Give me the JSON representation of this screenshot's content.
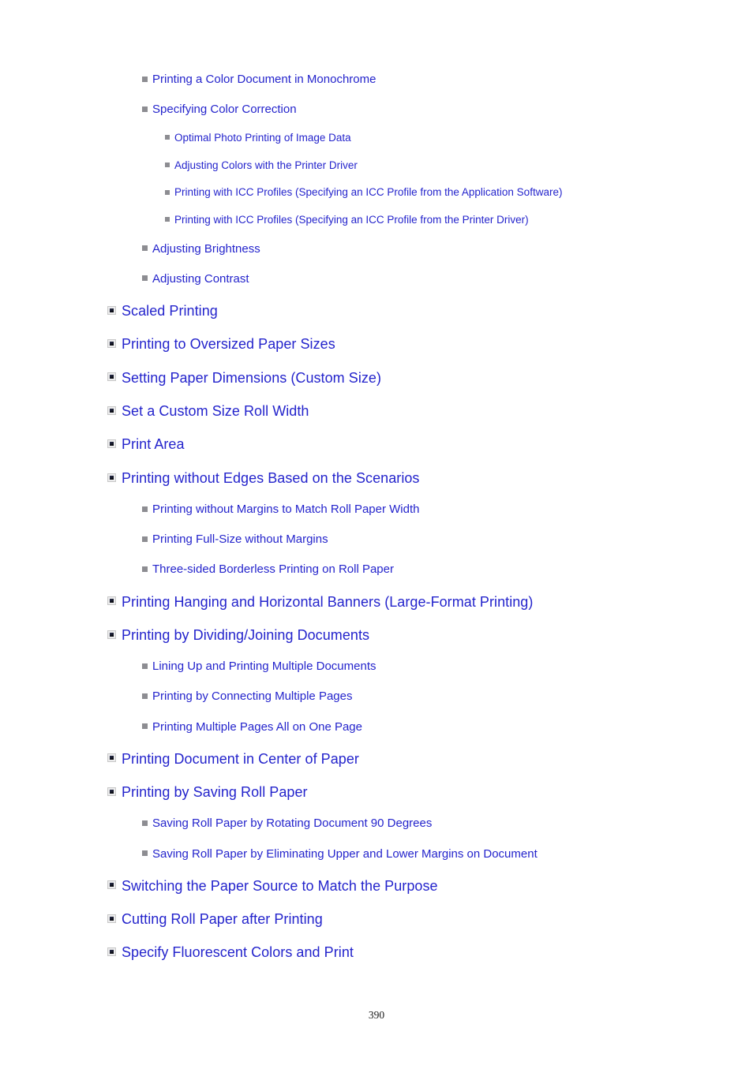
{
  "document": {
    "page_number": "390",
    "link_color": "#2424cc",
    "bullet_level1_color": "#17192c",
    "bullet_sub_color": "#8d8d92",
    "background_color": "#ffffff"
  },
  "toc": {
    "items": [
      {
        "level": 2,
        "bullet": "square-bullet-gray",
        "label": "Printing a Color Document in Monochrome"
      },
      {
        "level": 2,
        "bullet": "square-bullet-gray",
        "label": "Specifying Color Correction"
      },
      {
        "level": 3,
        "bullet": "square-bullet-gray-small",
        "label": "Optimal Photo Printing of Image Data"
      },
      {
        "level": 3,
        "bullet": "square-bullet-gray-small",
        "label": "Adjusting Colors with the Printer Driver"
      },
      {
        "level": 3,
        "bullet": "square-bullet-gray-small",
        "label": "Printing with ICC Profiles (Specifying an ICC Profile from the Application Software)"
      },
      {
        "level": 3,
        "bullet": "square-bullet-gray-small",
        "label": "Printing with ICC Profiles (Specifying an ICC Profile from the Printer Driver)"
      },
      {
        "level": 2,
        "bullet": "square-bullet-gray",
        "label": "Adjusting Brightness"
      },
      {
        "level": 2,
        "bullet": "square-bullet-gray",
        "label": "Adjusting Contrast"
      },
      {
        "level": 1,
        "bullet": "square-bullet-framed",
        "label": "Scaled Printing"
      },
      {
        "level": 1,
        "bullet": "square-bullet-framed",
        "label": "Printing to Oversized Paper Sizes"
      },
      {
        "level": 1,
        "bullet": "square-bullet-framed",
        "label": "Setting Paper Dimensions (Custom Size)"
      },
      {
        "level": 1,
        "bullet": "square-bullet-framed",
        "label": "Set a Custom Size Roll Width"
      },
      {
        "level": 1,
        "bullet": "square-bullet-framed",
        "label": "Print Area"
      },
      {
        "level": 1,
        "bullet": "square-bullet-framed",
        "label": "Printing without Edges Based on the Scenarios"
      },
      {
        "level": 2,
        "bullet": "square-bullet-gray",
        "label": "Printing without Margins to Match Roll Paper Width"
      },
      {
        "level": 2,
        "bullet": "square-bullet-gray",
        "label": "Printing Full-Size without Margins"
      },
      {
        "level": 2,
        "bullet": "square-bullet-gray",
        "label": "Three-sided Borderless Printing on Roll Paper"
      },
      {
        "level": 1,
        "bullet": "square-bullet-framed",
        "label": "Printing Hanging and Horizontal Banners (Large-Format Printing)"
      },
      {
        "level": 1,
        "bullet": "square-bullet-framed",
        "label": "Printing by Dividing/Joining Documents"
      },
      {
        "level": 2,
        "bullet": "square-bullet-gray",
        "label": "Lining Up and Printing Multiple Documents"
      },
      {
        "level": 2,
        "bullet": "square-bullet-gray",
        "label": "Printing by Connecting Multiple Pages"
      },
      {
        "level": 2,
        "bullet": "square-bullet-gray",
        "label": "Printing Multiple Pages All on One Page"
      },
      {
        "level": 1,
        "bullet": "square-bullet-framed",
        "label": "Printing Document in Center of Paper"
      },
      {
        "level": 1,
        "bullet": "square-bullet-framed",
        "label": "Printing by Saving Roll Paper"
      },
      {
        "level": 2,
        "bullet": "square-bullet-gray",
        "label": "Saving Roll Paper by Rotating Document 90 Degrees"
      },
      {
        "level": 2,
        "bullet": "square-bullet-gray",
        "label": "Saving Roll Paper by Eliminating Upper and Lower Margins on Document"
      },
      {
        "level": 1,
        "bullet": "square-bullet-framed",
        "label": "Switching the Paper Source to Match the Purpose"
      },
      {
        "level": 1,
        "bullet": "square-bullet-framed",
        "label": "Cutting Roll Paper after Printing"
      },
      {
        "level": 1,
        "bullet": "square-bullet-framed",
        "label": "Specify Fluorescent Colors and Print"
      }
    ]
  }
}
